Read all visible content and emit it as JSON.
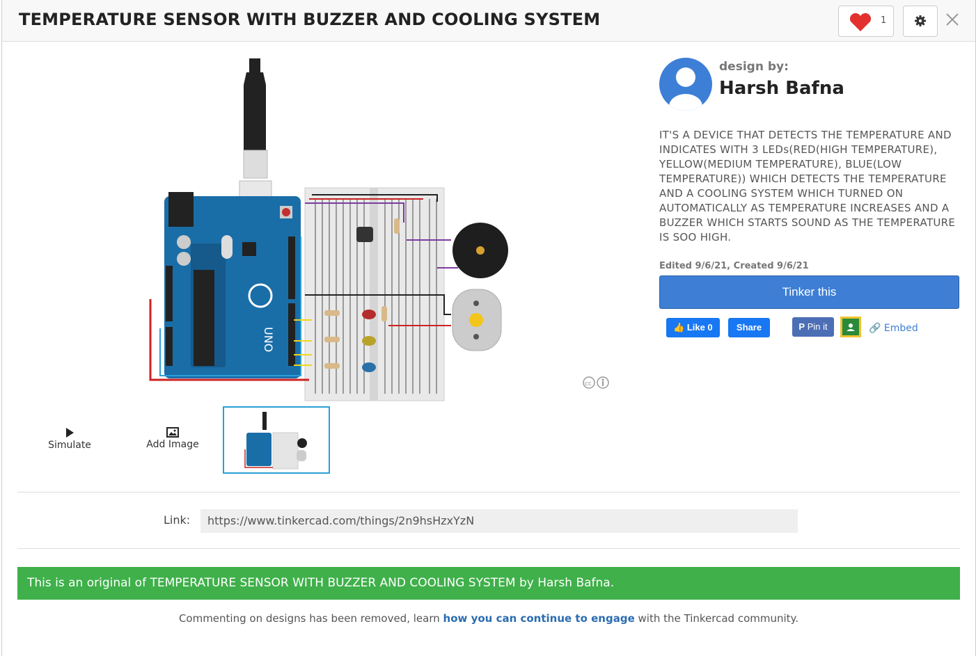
{
  "header": {
    "title": "TEMPERATURE SENSOR WITH BUZZER AND COOLING SYSTEM",
    "like_count": "1"
  },
  "controls": {
    "simulate_label": "Simulate",
    "add_image_label": "Add Image"
  },
  "designer": {
    "designby_label": "design by:",
    "name": "Harsh Bafna"
  },
  "description": "IT'S A DEVICE THAT DETECTS THE TEMPERATURE AND INDICATES WITH 3 LEDs(RED(HIGH TEMPERATURE), YELLOW(MEDIUM TEMPERATURE), BLUE(LOW TEMPERATURE)) WHICH DETECTS THE TEMPERATURE AND A COOLING SYSTEM WHICH TURNED ON AUTOMATICALLY AS TEMPERATURE INCREASES AND A BUZZER WHICH STARTS SOUND AS THE TEMPERATURE IS SOO HIGH.",
  "edited": "Edited 9/6/21, Created 9/6/21",
  "tinker_label": "Tinker this",
  "social": {
    "fb_like": "Like 0",
    "fb_share": "Share",
    "pin": "Pin it",
    "embed": "Embed"
  },
  "link": {
    "label": "Link:",
    "value": "https://www.tinkercad.com/things/2n9hsHzxYzN"
  },
  "banner": "This is an original of TEMPERATURE SENSOR WITH BUZZER AND COOLING SYSTEM by Harsh Bafna.",
  "footer": {
    "before": "Commenting on designs has been removed, learn ",
    "link": "how you can continue to engage",
    "after": " with the Tinkercad community."
  },
  "colors": {
    "accent": "#3e7fd5",
    "banner": "#3fb04a",
    "facebook": "#1877f2",
    "pinterest": "#4b6eb5"
  }
}
